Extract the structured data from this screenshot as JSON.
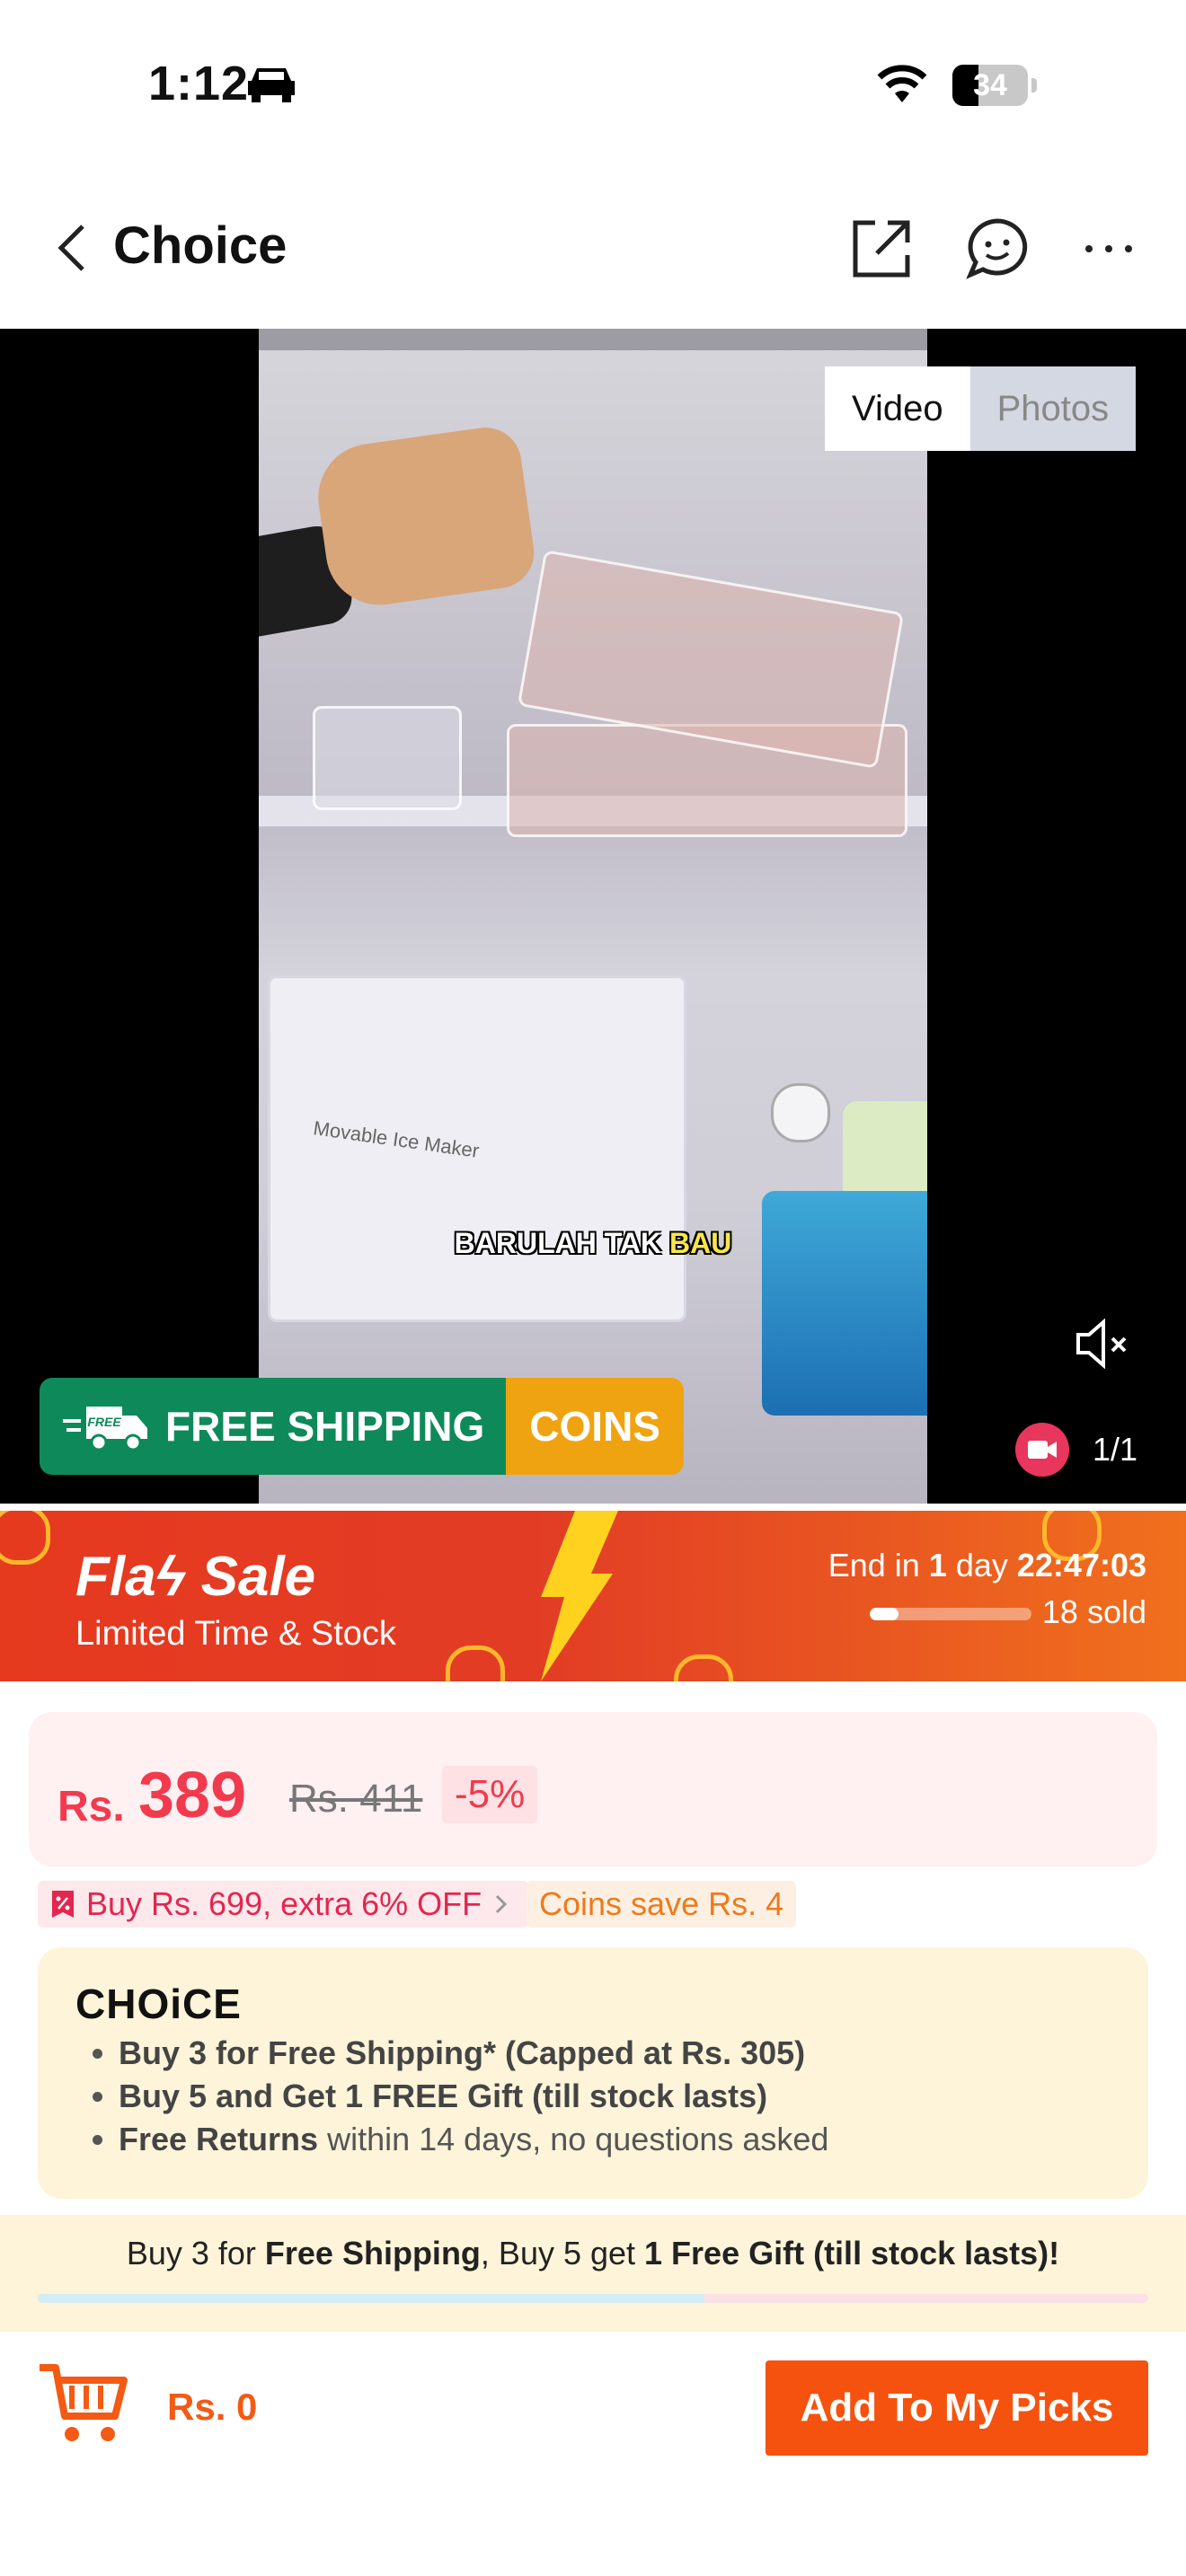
{
  "status_bar": {
    "time": "1:12",
    "battery": "34",
    "battery_level": 0.34
  },
  "nav": {
    "title": "Choice"
  },
  "media": {
    "caption_white": "BARULAH TAK ",
    "caption_yellow": "BAU",
    "fridge_label": "Movable Ice Maker",
    "tab_video": "Video",
    "tab_photos": "Photos",
    "counter": "1/1",
    "badge_ship": "FREE SHIPPING",
    "badge_ship_icon_text": "FREE",
    "badge_coins": "COINS"
  },
  "flash_sale": {
    "title": "Flaϟ Sale",
    "subtitle": "Limited Time & Stock",
    "end_prefix": "End in ",
    "end_days": "1",
    "end_mid": " day ",
    "end_time": "22:47:03",
    "sold": "18 sold",
    "sold_progress": 0.18
  },
  "price": {
    "currency": "Rs.",
    "amount": "389",
    "original": "Rs. 411",
    "discount": "-5%"
  },
  "promo": {
    "extra_off": "Buy Rs. 699, extra 6% OFF",
    "coins_save": "Coins save Rs. 4"
  },
  "choice": {
    "logo": "CHOiCE",
    "bullets": [
      {
        "bold": "Buy 3 for  Free Shipping* (Capped at Rs. 305)",
        "rest": ""
      },
      {
        "bold": "Buy 5 and Get 1 FREE Gift (till stock lasts)",
        "rest": ""
      },
      {
        "bold": "Free Returns",
        "rest": " within 14 days, no questions asked"
      }
    ]
  },
  "shipping_banner": {
    "p1": "Buy 3 for ",
    "b1": "Free Shipping",
    "p2": ", Buy 5 get ",
    "b2": "1 Free Gift (till stock lasts)!",
    "progress": 0.6
  },
  "bottom": {
    "total": "Rs. 0",
    "add_button": "Add To My Picks"
  },
  "colors": {
    "accent": "#f5520f",
    "price": "#f23a4e",
    "ship_green": "#0e8a5a",
    "coins_orange": "#f0a311"
  }
}
